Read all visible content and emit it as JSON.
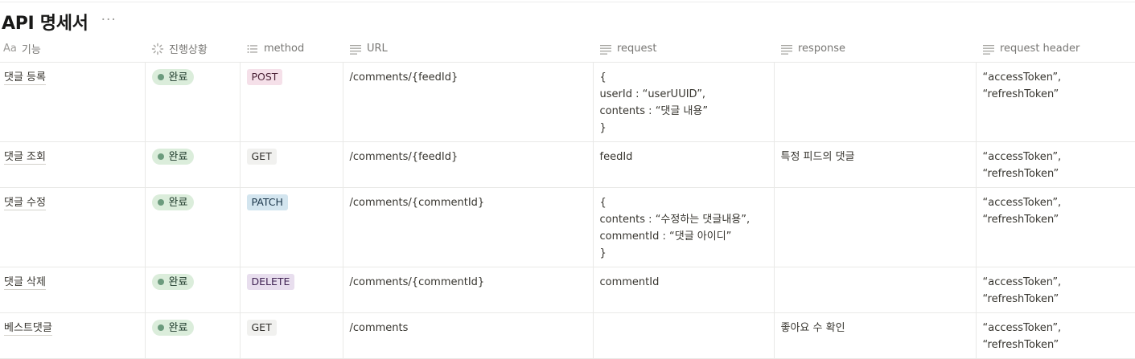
{
  "page": {
    "title": "API 명세서",
    "more_icon": "ellipsis-icon",
    "more_label": "···"
  },
  "columns": [
    {
      "key": "name",
      "label": "기능",
      "icon": "title-aa-icon",
      "icon_label": "Aa"
    },
    {
      "key": "status",
      "label": "진행상황",
      "icon": "status-spinner-icon"
    },
    {
      "key": "method",
      "label": "method",
      "icon": "list-icon"
    },
    {
      "key": "url",
      "label": "URL",
      "icon": "text-lines-icon"
    },
    {
      "key": "request",
      "label": "request",
      "icon": "text-lines-icon"
    },
    {
      "key": "response",
      "label": "response",
      "icon": "text-lines-icon"
    },
    {
      "key": "request_header",
      "label": "request header",
      "icon": "text-lines-icon"
    }
  ],
  "rows": [
    {
      "name": "댓글 등록",
      "status": "완료",
      "method": "POST",
      "url": "/comments/{feedId}",
      "request": [
        "{",
        "userId : “userUUID”,",
        "contents : “댓글 내용”",
        "}"
      ],
      "response": "",
      "request_header": [
        "“accessToken”,",
        "“refreshToken”"
      ]
    },
    {
      "name": "댓글 조회",
      "status": "완료",
      "method": "GET",
      "url": "/comments/{feedId}",
      "request": [
        "feedId"
      ],
      "response": "특정 피드의 댓글",
      "request_header": [
        "“accessToken”,",
        "“refreshToken”"
      ]
    },
    {
      "name": "댓글 수정",
      "status": "완료",
      "method": "PATCH",
      "url": "/comments/{commentId}",
      "request": [
        "{",
        "contents : “수정하는 댓글내용”,",
        "commentId : “댓글 아이디”",
        "}"
      ],
      "response": "",
      "request_header": [
        "“accessToken”,",
        "“refreshToken”"
      ]
    },
    {
      "name": "댓글 삭제",
      "status": "완료",
      "method": "DELETE",
      "url": "/comments/{commentId}",
      "request": [
        "commentId"
      ],
      "response": "",
      "request_header": [
        "“accessToken”,",
        "“refreshToken”"
      ]
    },
    {
      "name": "베스트댓글",
      "status": "완료",
      "method": "GET",
      "url": "/comments",
      "request": [],
      "response": "좋아요 수 확인",
      "request_header": [
        "“accessToken”,",
        "“refreshToken”"
      ]
    }
  ],
  "colors": {
    "status_bg": "#dbeddb",
    "status_dot": "#6c9b7d",
    "status_text": "#1c3829",
    "method_post_bg": "#f5e0e9",
    "method_post_text": "#4c2337",
    "method_get_bg": "#f1f1ef",
    "method_get_text": "#32302c",
    "method_patch_bg": "#d3e5ef",
    "method_patch_text": "#183347",
    "method_delete_bg": "#e8deee",
    "method_delete_text": "#412454"
  }
}
